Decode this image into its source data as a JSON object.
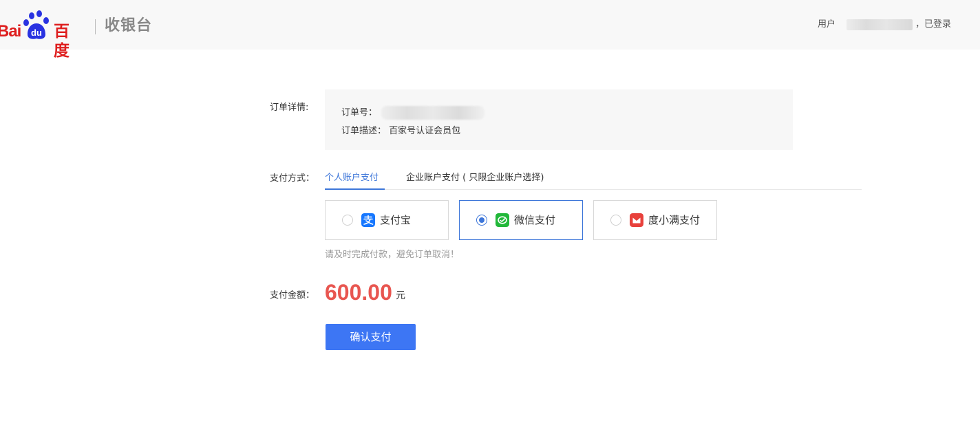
{
  "header": {
    "brand_latin": "Bai",
    "brand_du": "du",
    "brand_cn": "百度",
    "subtitle": "收银台",
    "user_prefix": "用户",
    "user_suffix": "，已登录"
  },
  "order": {
    "label": "订单详情:",
    "number_label": "订单号：",
    "description_label": "订单描述：",
    "description_value": "百家号认证会员包"
  },
  "payment": {
    "label": "支付方式：",
    "tabs": [
      {
        "label": "个人账户支付",
        "active": true
      },
      {
        "label": "企业账户支付 ( 只限企业账户选择)",
        "active": false
      }
    ],
    "methods": [
      {
        "name": "支付宝",
        "icon": "alipay-icon",
        "color": "#1677ff",
        "selected": false
      },
      {
        "name": "微信支付",
        "icon": "wechat-pay-icon",
        "color": "#22b83a",
        "selected": true
      },
      {
        "name": "度小满支付",
        "icon": "duxiaoman-icon",
        "color": "#e8413c",
        "selected": false
      }
    ],
    "hint": "请及时完成付款，避免订单取消！"
  },
  "amount": {
    "label": "支付金额：",
    "value": "600.00",
    "unit": "元"
  },
  "confirm_button": "确认支付",
  "colors": {
    "accent": "#3d76d9",
    "button": "#3d76f4",
    "amount": "#e85650",
    "brand_red": "#de1e1e",
    "brand_blue": "#2932e1"
  }
}
